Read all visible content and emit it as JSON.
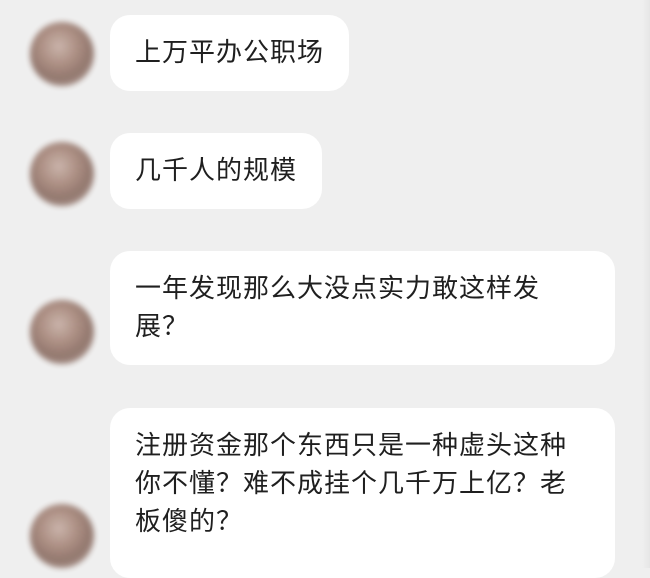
{
  "messages": [
    {
      "text": "上万平办公职场"
    },
    {
      "text": "几千人的规模"
    },
    {
      "text": "一年发现那么大没点实力敢这样发展？"
    },
    {
      "text": "注册资金那个东西只是一种虚头这种你不懂？难不成挂个几千万上亿？老板傻的？"
    }
  ]
}
